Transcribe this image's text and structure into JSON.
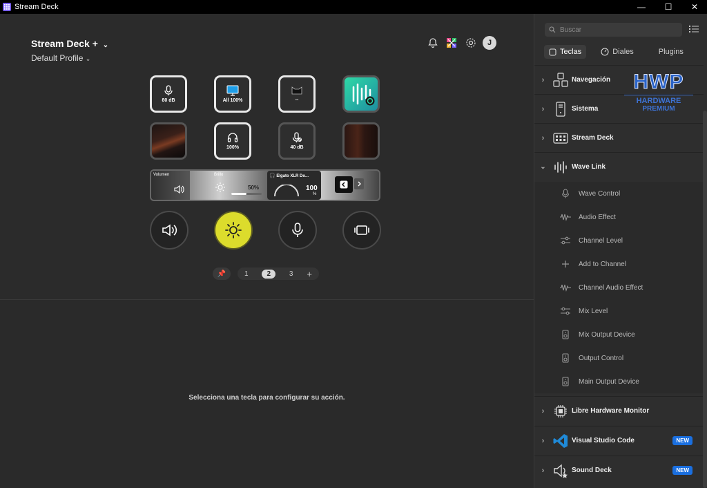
{
  "window": {
    "title": "Stream Deck",
    "controls": {
      "minimize": "—",
      "maximize": "☐",
      "close": "✕"
    }
  },
  "header": {
    "device_name": "Stream Deck +",
    "profile_name": "Default Profile",
    "avatar_initial": "J",
    "icons": [
      "bell-icon",
      "multiaction-icon",
      "settings-icon"
    ]
  },
  "keys": [
    {
      "label": "80 dB",
      "icon": "microphone-icon"
    },
    {
      "label": "All 100%",
      "icon": "monitor-icon"
    },
    {
      "label": "--",
      "icon": "cat-icon"
    },
    {
      "label": "",
      "icon": "wave-link-icon"
    },
    {
      "label": "",
      "icon": "photo"
    },
    {
      "label": "100%",
      "icon": "headphones-icon"
    },
    {
      "label": "40 dB",
      "icon": "microphone-muted-icon"
    },
    {
      "label": "",
      "icon": "photo"
    }
  ],
  "touch_strip": {
    "volume_label": "Volumen",
    "brightness_label": "Brillo",
    "brightness_value": "50%",
    "device_label": "Elgato XLR Do...",
    "device_value": "100",
    "device_unit": "%"
  },
  "dials": [
    "speaker-icon",
    "brightness-icon",
    "microphone-icon",
    "screen-capture-icon"
  ],
  "pager": {
    "pages": [
      "1",
      "2",
      "3"
    ],
    "current": "2",
    "add": "+"
  },
  "hint": "Selecciona una tecla para configurar su acción.",
  "sidebar": {
    "search_placeholder": "Buscar",
    "tabs": [
      "Teclas",
      "Diales",
      "Plugins"
    ],
    "active_tab": "Teclas",
    "categories_top": [
      {
        "label": "Navegación",
        "icon": "navigation-icon"
      },
      {
        "label": "Sistema",
        "icon": "computer-icon"
      },
      {
        "label": "Stream Deck",
        "icon": "stream-deck-icon"
      },
      {
        "label": "Wave Link",
        "icon": "wave-link-icon"
      }
    ],
    "wave_link_actions": [
      {
        "label": "Wave Control",
        "icon": "microphone-icon"
      },
      {
        "label": "Audio Effect",
        "icon": "waveform-icon"
      },
      {
        "label": "Channel Level",
        "icon": "sliders-icon"
      },
      {
        "label": "Add to Channel",
        "icon": "plus-icon"
      },
      {
        "label": "Channel Audio Effect",
        "icon": "waveform-icon"
      },
      {
        "label": "Mix Level",
        "icon": "sliders-icon"
      },
      {
        "label": "Mix Output Device",
        "icon": "speaker-box-icon"
      },
      {
        "label": "Output Control",
        "icon": "speaker-box-icon"
      },
      {
        "label": "Main Output Device",
        "icon": "speaker-box-icon"
      }
    ],
    "categories_bottom": [
      {
        "label": "Libre Hardware Monitor",
        "icon": "chip-icon",
        "badge": ""
      },
      {
        "label": "Visual Studio Code",
        "icon": "vscode-icon",
        "badge": "NEW"
      },
      {
        "label": "Sound Deck",
        "icon": "sound-deck-icon",
        "badge": "NEW"
      }
    ],
    "watermark": {
      "big": "HWP",
      "line2": "HARDWARE",
      "line3": "PREMIUM"
    }
  }
}
